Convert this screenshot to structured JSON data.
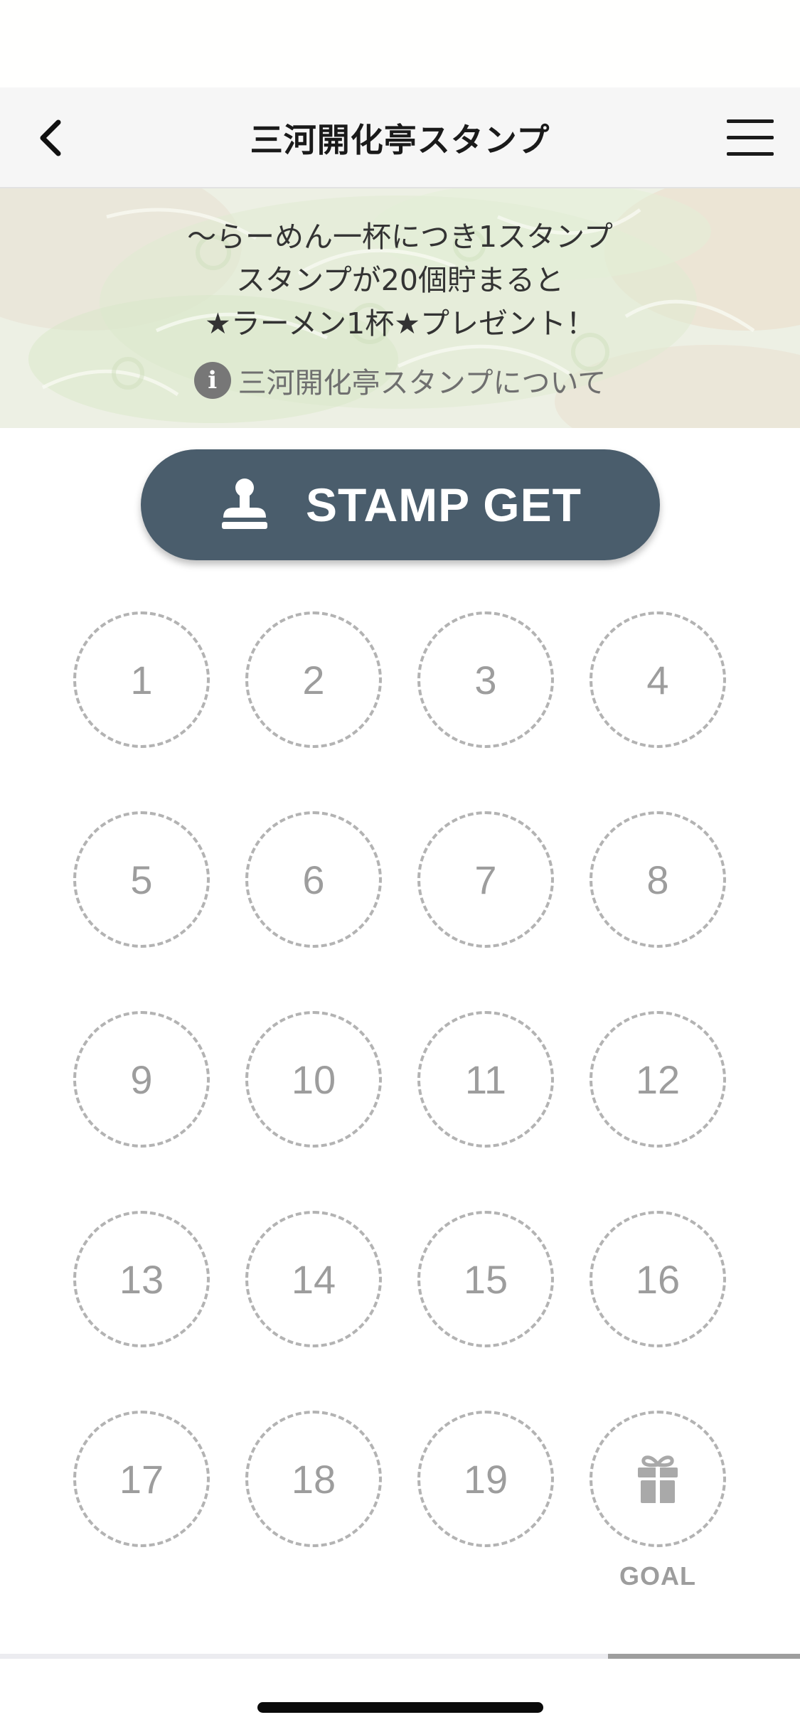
{
  "header": {
    "title": "三河開化亭スタンプ",
    "back_icon": "chevron-left-icon",
    "menu_icon": "hamburger-menu-icon"
  },
  "banner": {
    "lines": [
      "〜らーめん一杯につき1スタンプ",
      "スタンプが20個貯まると",
      "★ラーメン1杯★プレゼント！"
    ],
    "info_link": "三河開化亭スタンプについて",
    "info_icon": "info-icon"
  },
  "stamp_button": {
    "label": "STAMP GET",
    "icon": "stamp-icon",
    "color": "#4a5d6c"
  },
  "stamp_card": {
    "slots": [
      "1",
      "2",
      "3",
      "4",
      "5",
      "6",
      "7",
      "8",
      "9",
      "10",
      "11",
      "12",
      "13",
      "14",
      "15",
      "16",
      "17",
      "18",
      "19"
    ],
    "goal_label": "GOAL",
    "goal_icon": "gift-icon",
    "collected": 0
  },
  "pager": {
    "progress": 0.24
  }
}
